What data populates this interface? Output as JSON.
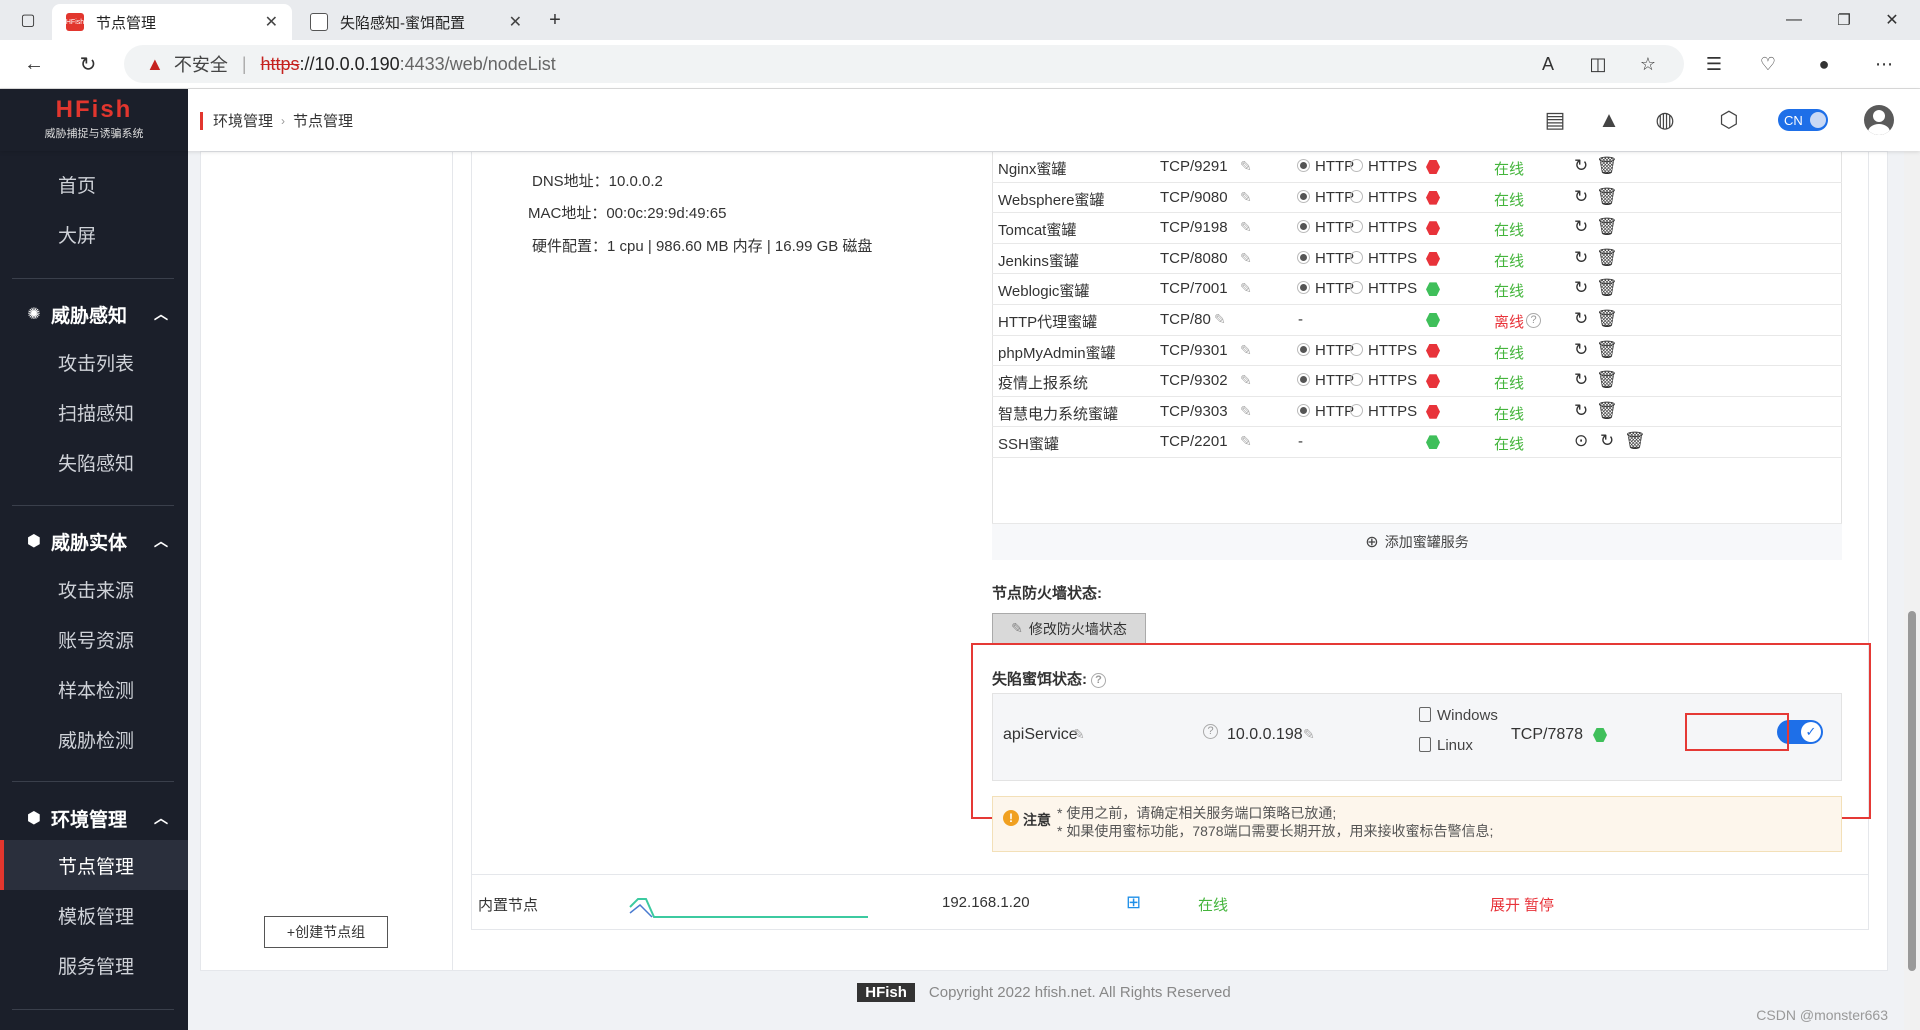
{
  "browser": {
    "tabs": [
      {
        "title": "节点管理",
        "favicon": "HFish"
      },
      {
        "title": "失陷感知-蜜饵配置"
      }
    ],
    "insecure_label": "不安全",
    "url": {
      "proto": "https",
      "host": "://10.0.0.190",
      "path": ":4433/web/nodeList"
    }
  },
  "app": {
    "logo_name": "HFish",
    "logo_sub": "威胁捕捉与诱骗系统",
    "breadcrumb": [
      "环境管理",
      "节点管理"
    ],
    "lang": "CN"
  },
  "sidebar": {
    "top_items": [
      "首页",
      "大屏"
    ],
    "groups": [
      {
        "label": "威胁感知",
        "items": [
          "攻击列表",
          "扫描感知",
          "失陷感知"
        ]
      },
      {
        "label": "威胁实体",
        "items": [
          "攻击来源",
          "账号资源",
          "样本检测",
          "威胁检测"
        ]
      },
      {
        "label": "环境管理",
        "items": [
          "节点管理",
          "模板管理",
          "服务管理"
        ]
      }
    ],
    "active": "节点管理"
  },
  "node_info": {
    "dns_label": "DNS地址：",
    "dns": "10.0.0.2",
    "mac_label": "MAC地址：",
    "mac": "00:0c:29:9d:49:65",
    "hw_label": "硬件配置：",
    "hw": "1 cpu | 986.60 MB 内存 | 16.99 GB 磁盘"
  },
  "services": [
    {
      "name": "Nginx蜜罐",
      "port": "TCP/9291",
      "proto": true,
      "status_color": "red",
      "status": "在线"
    },
    {
      "name": "Websphere蜜罐",
      "port": "TCP/9080",
      "proto": true,
      "status_color": "red",
      "status": "在线"
    },
    {
      "name": "Tomcat蜜罐",
      "port": "TCP/9198",
      "proto": true,
      "status_color": "red",
      "status": "在线"
    },
    {
      "name": "Jenkins蜜罐",
      "port": "TCP/8080",
      "proto": true,
      "status_color": "red",
      "status": "在线"
    },
    {
      "name": "Weblogic蜜罐",
      "port": "TCP/7001",
      "proto": true,
      "status_color": "green",
      "status": "在线"
    },
    {
      "name": "HTTP代理蜜罐",
      "port": "TCP/80",
      "proto": false,
      "status_color": "green",
      "status": "离线"
    },
    {
      "name": "phpMyAdmin蜜罐",
      "port": "TCP/9301",
      "proto": true,
      "status_color": "red",
      "status": "在线"
    },
    {
      "name": "疫情上报系统",
      "port": "TCP/9302",
      "proto": true,
      "status_color": "red",
      "status": "在线"
    },
    {
      "name": "智慧电力系统蜜罐",
      "port": "TCP/9303",
      "proto": true,
      "status_color": "red",
      "status": "在线"
    },
    {
      "name": "SSH蜜罐",
      "port": "TCP/2201",
      "proto": false,
      "status_color": "green",
      "status": "在线"
    }
  ],
  "proto_labels": {
    "http": "HTTP",
    "https": "HTTPS",
    "none": "-"
  },
  "add_service": "添加蜜罐服务",
  "firewall": {
    "label": "节点防火墙状态:",
    "button": "修改防火墙状态"
  },
  "decoy": {
    "label": "失陷蜜饵状态:",
    "name": "apiService",
    "ip": "10.0.0.198",
    "os_windows": "Windows",
    "os_linux": "Linux",
    "port": "TCP/7878",
    "enabled": true
  },
  "notice": {
    "title": "注意",
    "line1": "* 使用之前，请确定相关服务端口策略已放通;",
    "line2": "* 如果使用蜜标功能，7878端口需要长期开放，用来接收蜜标告警信息;"
  },
  "node_row": {
    "name": "内置节点",
    "ip": "192.168.1.20",
    "status": "在线",
    "expand": "展开",
    "pause": "暂停"
  },
  "create_group": "+创建节点组",
  "footer": {
    "badge": "HFish",
    "copyright": "Copyright 2022 hfish.net. All Rights Reserved"
  },
  "watermark": "CSDN @monster663"
}
